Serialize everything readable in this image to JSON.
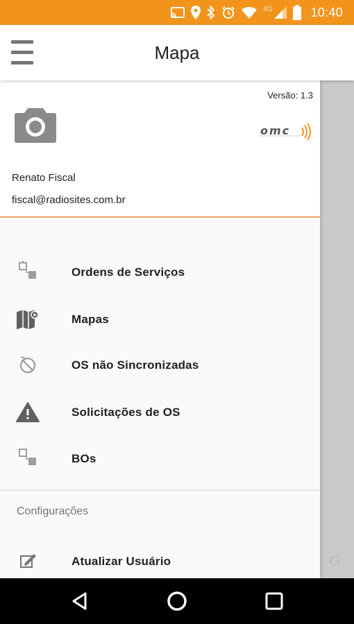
{
  "status_bar": {
    "time": "10:40",
    "network": "4G",
    "icons": [
      "cast-icon",
      "location-icon",
      "bluetooth-icon",
      "alarm-icon",
      "wifi-icon",
      "signal-icon",
      "battery-icon"
    ],
    "color": "#F2941B"
  },
  "app_bar": {
    "title": "Mapa",
    "menu_icon": "hamburger-menu-icon"
  },
  "drawer": {
    "version": "Versão: 1.3",
    "avatar_icon": "camera-icon",
    "logo_text": "omc",
    "user_name": "Renato Fiscal",
    "user_email": "fiscal@radiosites.com.br",
    "accent_color": "#E8A55A",
    "items": [
      {
        "label": "Ordens de Serviços",
        "icon": "service-orders-icon"
      },
      {
        "label": "Mapas",
        "icon": "map-icon"
      },
      {
        "label": "OS não Sincronizadas",
        "icon": "sync-disabled-icon"
      },
      {
        "label": "Solicitações de OS",
        "icon": "warning-icon"
      },
      {
        "label": "BOs",
        "icon": "bo-icon"
      }
    ],
    "section_title": "Configurações",
    "settings_items": [
      {
        "label": "Atualizar Usuário",
        "icon": "edit-icon"
      }
    ]
  },
  "nav_bar": {
    "buttons": [
      "back-icon",
      "home-icon",
      "recents-icon"
    ]
  }
}
